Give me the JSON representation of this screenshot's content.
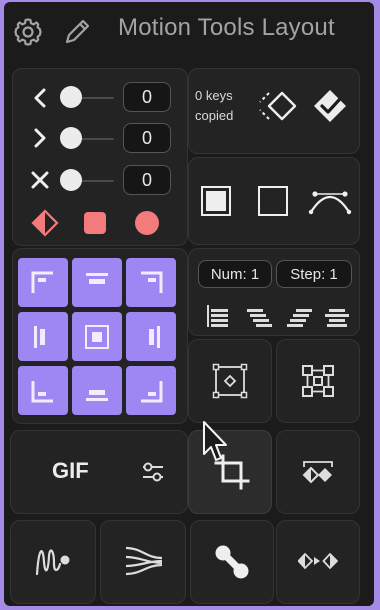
{
  "header": {
    "title": "Motion Tools Layout",
    "settings_icon": "gear-icon",
    "edit_icon": "pencil-icon"
  },
  "anchor_panel": {
    "rows": [
      {
        "icon": "chevron-left-icon",
        "value": "0"
      },
      {
        "icon": "chevron-right-icon",
        "value": "0"
      },
      {
        "icon": "x-icon",
        "value": "0"
      }
    ],
    "shape_icons": [
      "half-diamond-icon",
      "square-icon",
      "circle-icon"
    ]
  },
  "keys_panel": {
    "status_line1": "0 keys",
    "status_line2": "copied",
    "icons": [
      "copy-keys-icon",
      "paste-keys-icon"
    ]
  },
  "shapes_panel": {
    "icons": [
      "filled-square-icon",
      "outline-square-icon",
      "bezier-curve-icon"
    ]
  },
  "align_panel": {
    "cells": [
      "align-top-left",
      "align-top-center",
      "align-top-right",
      "align-middle-left",
      "align-center",
      "align-middle-right",
      "align-bottom-left",
      "align-bottom-center",
      "align-bottom-right"
    ]
  },
  "sequence_panel": {
    "num_label": "Num: 1",
    "step_label": "Step: 1",
    "icons": [
      "sequence-stagger-1-icon",
      "sequence-stagger-2-icon",
      "sequence-stagger-3-icon",
      "sequence-stagger-4-icon"
    ]
  },
  "tools": {
    "gif_label": "GIF",
    "gif_settings_icon": "sliders-icon",
    "anchor_box_icon": "anchor-box-icon",
    "distribute_icon": "distribute-nodes-icon",
    "crop_icon": "crop-icon",
    "split_keys_icon": "split-keyframes-icon",
    "wiggle_icon": "wiggle-icon",
    "trails_icon": "motion-trails-icon",
    "connect_icon": "connect-nodes-icon",
    "keyframe_ease_icon": "keyframe-ease-icon"
  },
  "colors": {
    "accent": "#9f87f3",
    "frame": "#a58ae6",
    "shape_red": "#f47b7b",
    "background": "#1b1b1b"
  }
}
